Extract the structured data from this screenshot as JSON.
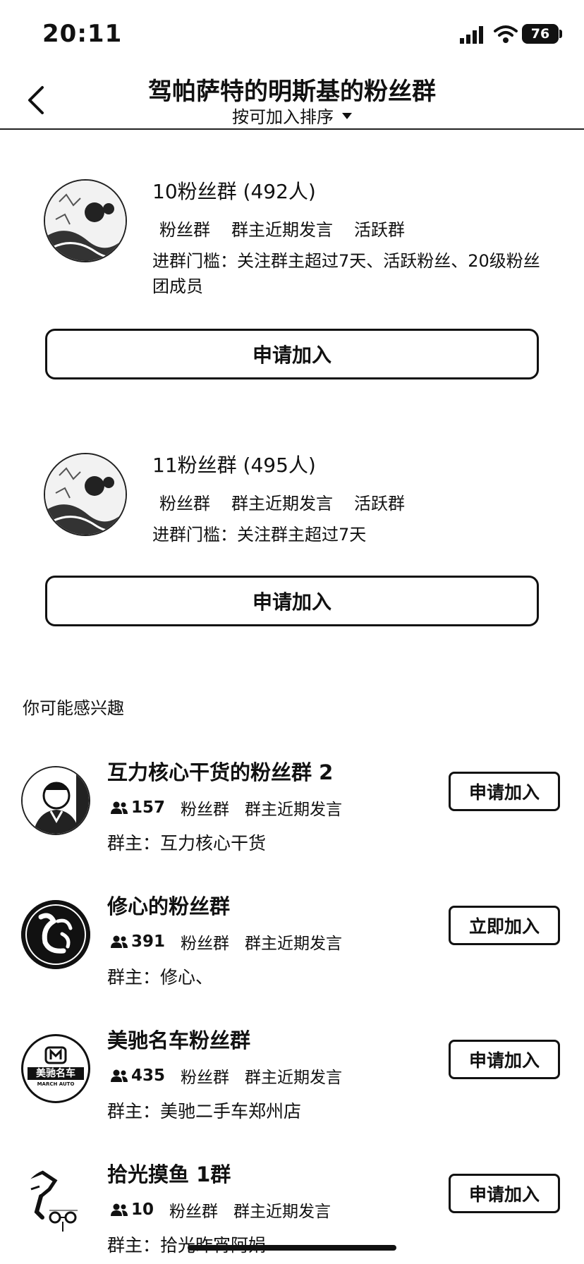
{
  "status_bar": {
    "time": "20:11",
    "battery": "76"
  },
  "header": {
    "title": "驾帕萨特的明斯基的粉丝群",
    "sort_label": "按可加入排序"
  },
  "fan_groups": [
    {
      "name": "10粉丝群 (492人)",
      "tags": [
        "粉丝群",
        "群主近期发言",
        "活跃群"
      ],
      "threshold": "进群门槛：关注群主超过7天、活跃粉丝、20级粉丝团成员",
      "button": "申请加入"
    },
    {
      "name": "11粉丝群 (495人)",
      "tags": [
        "粉丝群",
        "群主近期发言",
        "活跃群"
      ],
      "threshold": "进群门槛：关注群主超过7天",
      "button": "申请加入"
    }
  ],
  "recommend": {
    "title": "你可能感兴趣",
    "items": [
      {
        "name": "互力核心干货的粉丝群 2",
        "members": "157",
        "tags": [
          "粉丝群",
          "群主近期发言"
        ],
        "owner": "群主：互力核心干货",
        "button": "申请加入"
      },
      {
        "name": "修心的粉丝群",
        "members": "391",
        "tags": [
          "粉丝群",
          "群主近期发言"
        ],
        "owner": "群主：修心、",
        "button": "立即加入"
      },
      {
        "name": "美驰名车粉丝群",
        "members": "435",
        "tags": [
          "粉丝群",
          "群主近期发言"
        ],
        "owner": "群主：美驰二手车郑州店",
        "button": "申请加入",
        "logo_text": "美驰名车",
        "logo_subtext": "MARCH AUTO"
      },
      {
        "name": "拾光摸鱼 1群",
        "members": "10",
        "tags": [
          "粉丝群",
          "群主近期发言"
        ],
        "owner": "群主：拾光昨宵阿娟",
        "button": "申请加入"
      }
    ]
  }
}
